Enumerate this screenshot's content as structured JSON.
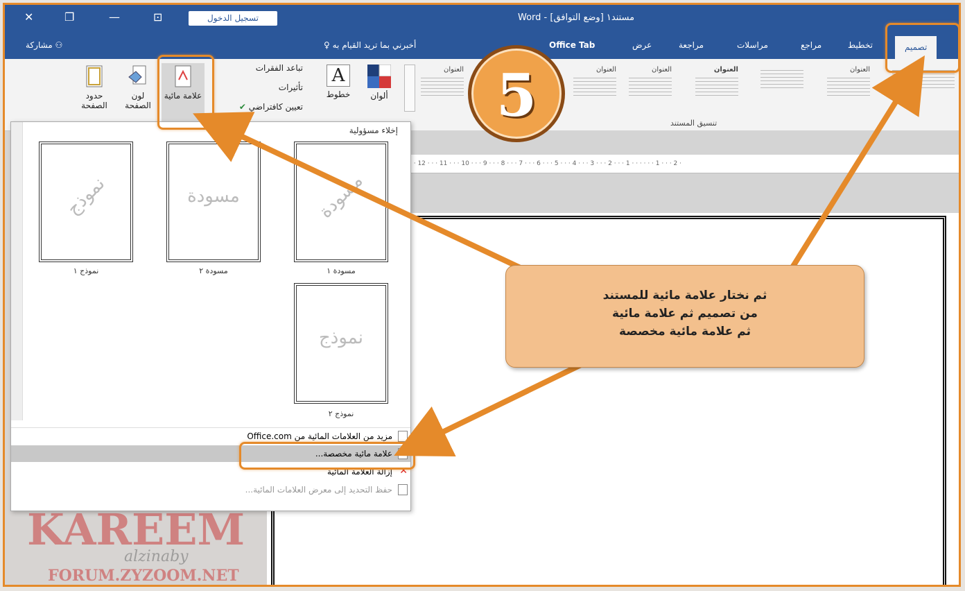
{
  "window": {
    "title": "مستند١ [وضع التوافق] - Word",
    "signin_label": "تسجيل الدخول",
    "controls": {
      "close": "✕",
      "restore": "❐",
      "minimize": "—",
      "display": "⊡"
    }
  },
  "tabs": {
    "share": "مشاركة",
    "tellme": "أخبرني بما تريد القيام به",
    "items": [
      "تصميم",
      "تخطيط",
      "مراجع",
      "مراسلات",
      "مراجعة",
      "عرض",
      "Office Tab"
    ],
    "active": "تصميم"
  },
  "ribbon": {
    "page_borders": "حدود الصفحة",
    "page_color": "لون الصفحة",
    "watermark": "علامة مائية",
    "paragraph_spacing": "تباعد الفقرات",
    "effects": "تأثيرات",
    "set_default": "تعيين كافتراضي",
    "fonts": "خطوط",
    "colors": "ألوان",
    "gallery_title": "العنوان",
    "group_label": "تنسيق المستند"
  },
  "ruler": "· · 12 · · · 11 · · · 10 · · · 9 · · · 8 · · · 7 · · · 6 · · · 5 · · · 4 · · · 3 · · · 2 · · · 1 · · · · · · 1 · · · 2 ·",
  "dropdown": {
    "header": "إخلاء مسؤولية",
    "thumbs": [
      {
        "text": "نموذج",
        "caption": "نموذج ١"
      },
      {
        "text": "مسودة",
        "caption": "مسودة ٢"
      },
      {
        "text": "مسودة",
        "caption": "مسودة ١"
      },
      {
        "text": "نموذج",
        "caption": "نموذج ٢"
      }
    ],
    "more_watermarks": "مزيد من العلامات المائية من Office.com",
    "custom_watermark": "علامة مائية مخصصة...",
    "remove_watermark": "إزالة العلامة المائية",
    "save_selection": "حفظ التحديد إلى معرض العلامات المائية..."
  },
  "badge_number": "5",
  "callout": {
    "line1": "ثم نختار علامة مائية للمستند",
    "line2": "من تصميم ثم علامة مائية",
    "line3": "ثم علامة مائية مخصصة"
  },
  "logo": {
    "line1": "KAREEM",
    "line2": "alzinaby",
    "line3": "FORUM.ZYZOOM.NET"
  },
  "colors": {
    "titlebar": "#2b579a",
    "highlight": "#e58a2a",
    "callout": "#f3c08d"
  }
}
